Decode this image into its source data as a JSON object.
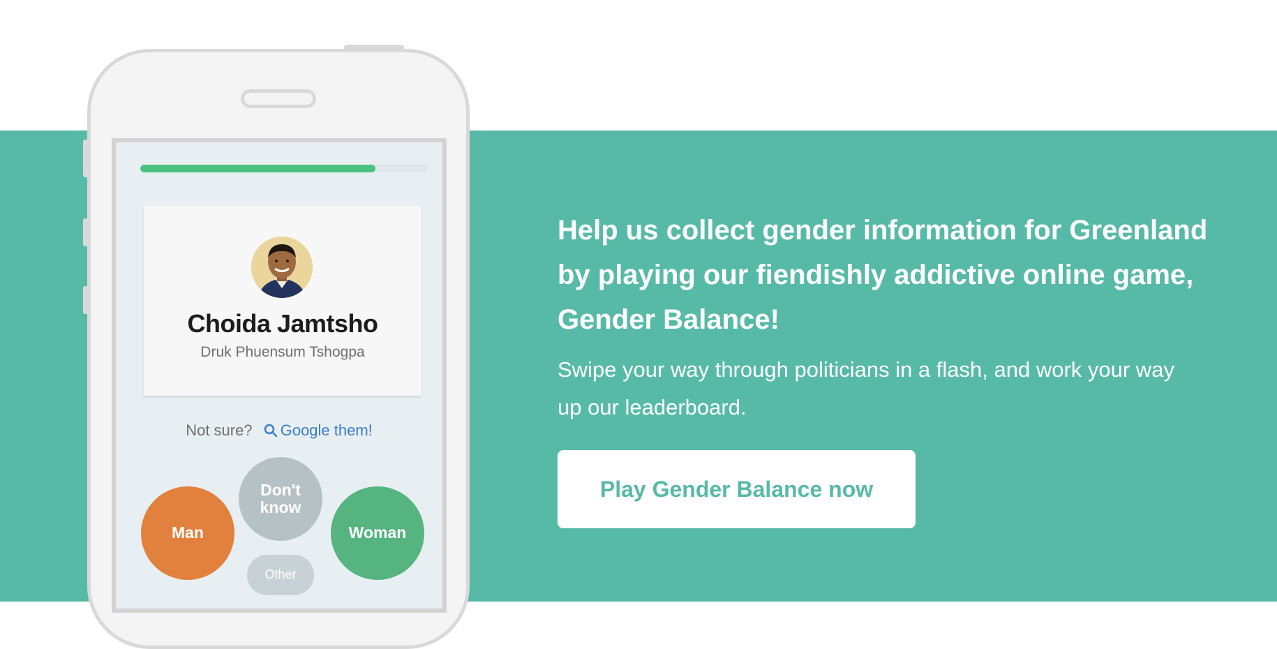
{
  "colors": {
    "band_background": "#57baa7",
    "progress_fill": "#49c27f",
    "man_button": "#e2803d",
    "dont_know_button": "#b6c1c6",
    "woman_button": "#55b47f",
    "other_button": "#c8d2d6",
    "link": "#3a7dc9",
    "cta_text": "#57baa7"
  },
  "phone": {
    "progress": 0.82,
    "card": {
      "avatar": "portrait-photo",
      "name": "Choida Jamtsho",
      "party": "Druk Phuensum Tshogpa"
    },
    "hint": {
      "not_sure": "Not sure?",
      "icon": "search-icon",
      "google_label": "Google them!"
    },
    "choices": {
      "man": "Man",
      "dont_know": "Don't know",
      "woman": "Woman",
      "other": "Other"
    }
  },
  "promo": {
    "headline": "Help us collect gender information for Greenland by playing our fiendishly addictive online game, Gender Balance!",
    "subtext": "Swipe your way through politicians in a flash, and work your way up our leaderboard.",
    "cta_label": "Play Gender Balance now"
  }
}
